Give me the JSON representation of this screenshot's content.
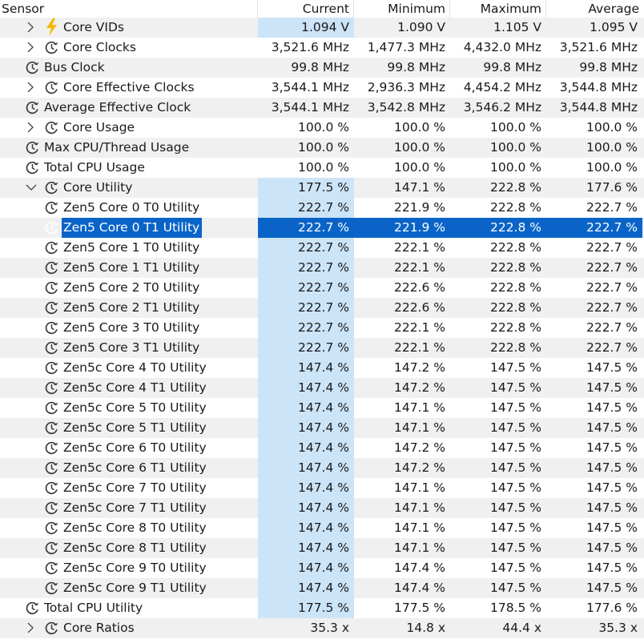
{
  "columns": {
    "sensor": "Sensor",
    "current": "Current",
    "minimum": "Minimum",
    "maximum": "Maximum",
    "average": "Average"
  },
  "rows": [
    {
      "name": "Core VIDs",
      "indent": 1,
      "expander": "collapsed",
      "icon": "lightning-icon",
      "current": "1.094 V",
      "minimum": "1.090 V",
      "maximum": "1.105 V",
      "average": "1.095 V",
      "current_highlight": true
    },
    {
      "name": "Core Clocks",
      "indent": 1,
      "expander": "collapsed",
      "icon": "clock-icon",
      "current": "3,521.6 MHz",
      "minimum": "1,477.3 MHz",
      "maximum": "4,432.0 MHz",
      "average": "3,521.6 MHz"
    },
    {
      "name": "Bus Clock",
      "indent": 0,
      "expander": "none",
      "icon": "clock-icon",
      "current": "99.8 MHz",
      "minimum": "99.8 MHz",
      "maximum": "99.8 MHz",
      "average": "99.8 MHz"
    },
    {
      "name": "Core Effective Clocks",
      "indent": 1,
      "expander": "collapsed",
      "icon": "clock-icon",
      "current": "3,544.1 MHz",
      "minimum": "2,936.3 MHz",
      "maximum": "4,454.2 MHz",
      "average": "3,544.8 MHz"
    },
    {
      "name": "Average Effective Clock",
      "indent": 0,
      "expander": "none",
      "icon": "clock-icon",
      "current": "3,544.1 MHz",
      "minimum": "3,542.8 MHz",
      "maximum": "3,546.2 MHz",
      "average": "3,544.8 MHz"
    },
    {
      "name": "Core Usage",
      "indent": 1,
      "expander": "collapsed",
      "icon": "clock-icon",
      "current": "100.0 %",
      "minimum": "100.0 %",
      "maximum": "100.0 %",
      "average": "100.0 %"
    },
    {
      "name": "Max CPU/Thread Usage",
      "indent": 0,
      "expander": "none",
      "icon": "clock-icon",
      "current": "100.0 %",
      "minimum": "100.0 %",
      "maximum": "100.0 %",
      "average": "100.0 %"
    },
    {
      "name": "Total CPU Usage",
      "indent": 0,
      "expander": "none",
      "icon": "clock-icon",
      "current": "100.0 %",
      "minimum": "100.0 %",
      "maximum": "100.0 %",
      "average": "100.0 %"
    },
    {
      "name": "Core Utility",
      "indent": 1,
      "expander": "expanded",
      "icon": "clock-icon",
      "current": "177.5 %",
      "minimum": "147.1 %",
      "maximum": "222.8 %",
      "average": "177.6 %",
      "current_highlight": true
    },
    {
      "name": "Zen5 Core 0 T0 Utility",
      "indent": 1,
      "expander": "none",
      "icon": "clock-icon",
      "current": "222.7 %",
      "minimum": "221.9 %",
      "maximum": "222.8 %",
      "average": "222.7 %",
      "current_highlight": true
    },
    {
      "name": "Zen5 Core 0 T1 Utility",
      "indent": 1,
      "expander": "none",
      "icon": "clock-icon",
      "current": "222.7 %",
      "minimum": "221.9 %",
      "maximum": "222.8 %",
      "average": "222.7 %",
      "selected": true
    },
    {
      "name": "Zen5 Core 1 T0 Utility",
      "indent": 1,
      "expander": "none",
      "icon": "clock-icon",
      "current": "222.7 %",
      "minimum": "222.1 %",
      "maximum": "222.8 %",
      "average": "222.7 %",
      "current_highlight": true
    },
    {
      "name": "Zen5 Core 1 T1 Utility",
      "indent": 1,
      "expander": "none",
      "icon": "clock-icon",
      "current": "222.7 %",
      "minimum": "222.1 %",
      "maximum": "222.8 %",
      "average": "222.7 %",
      "current_highlight": true
    },
    {
      "name": "Zen5 Core 2 T0 Utility",
      "indent": 1,
      "expander": "none",
      "icon": "clock-icon",
      "current": "222.7 %",
      "minimum": "222.6 %",
      "maximum": "222.8 %",
      "average": "222.7 %",
      "current_highlight": true
    },
    {
      "name": "Zen5 Core 2 T1 Utility",
      "indent": 1,
      "expander": "none",
      "icon": "clock-icon",
      "current": "222.7 %",
      "minimum": "222.6 %",
      "maximum": "222.8 %",
      "average": "222.7 %",
      "current_highlight": true
    },
    {
      "name": "Zen5 Core 3 T0 Utility",
      "indent": 1,
      "expander": "none",
      "icon": "clock-icon",
      "current": "222.7 %",
      "minimum": "222.1 %",
      "maximum": "222.8 %",
      "average": "222.7 %",
      "current_highlight": true
    },
    {
      "name": "Zen5 Core 3 T1 Utility",
      "indent": 1,
      "expander": "none",
      "icon": "clock-icon",
      "current": "222.7 %",
      "minimum": "222.1 %",
      "maximum": "222.8 %",
      "average": "222.7 %",
      "current_highlight": true
    },
    {
      "name": "Zen5c Core 4 T0 Utility",
      "indent": 1,
      "expander": "none",
      "icon": "clock-icon",
      "current": "147.4 %",
      "minimum": "147.2 %",
      "maximum": "147.5 %",
      "average": "147.5 %",
      "current_highlight": true
    },
    {
      "name": "Zen5c Core 4 T1 Utility",
      "indent": 1,
      "expander": "none",
      "icon": "clock-icon",
      "current": "147.4 %",
      "minimum": "147.2 %",
      "maximum": "147.5 %",
      "average": "147.5 %",
      "current_highlight": true
    },
    {
      "name": "Zen5c Core 5 T0 Utility",
      "indent": 1,
      "expander": "none",
      "icon": "clock-icon",
      "current": "147.4 %",
      "minimum": "147.1 %",
      "maximum": "147.5 %",
      "average": "147.5 %",
      "current_highlight": true
    },
    {
      "name": "Zen5c Core 5 T1 Utility",
      "indent": 1,
      "expander": "none",
      "icon": "clock-icon",
      "current": "147.4 %",
      "minimum": "147.1 %",
      "maximum": "147.5 %",
      "average": "147.5 %",
      "current_highlight": true
    },
    {
      "name": "Zen5c Core 6 T0 Utility",
      "indent": 1,
      "expander": "none",
      "icon": "clock-icon",
      "current": "147.4 %",
      "minimum": "147.2 %",
      "maximum": "147.5 %",
      "average": "147.5 %",
      "current_highlight": true
    },
    {
      "name": "Zen5c Core 6 T1 Utility",
      "indent": 1,
      "expander": "none",
      "icon": "clock-icon",
      "current": "147.4 %",
      "minimum": "147.2 %",
      "maximum": "147.5 %",
      "average": "147.5 %",
      "current_highlight": true
    },
    {
      "name": "Zen5c Core 7 T0 Utility",
      "indent": 1,
      "expander": "none",
      "icon": "clock-icon",
      "current": "147.4 %",
      "minimum": "147.1 %",
      "maximum": "147.5 %",
      "average": "147.5 %",
      "current_highlight": true
    },
    {
      "name": "Zen5c Core 7 T1 Utility",
      "indent": 1,
      "expander": "none",
      "icon": "clock-icon",
      "current": "147.4 %",
      "minimum": "147.1 %",
      "maximum": "147.5 %",
      "average": "147.5 %",
      "current_highlight": true
    },
    {
      "name": "Zen5c Core 8 T0 Utility",
      "indent": 1,
      "expander": "none",
      "icon": "clock-icon",
      "current": "147.4 %",
      "minimum": "147.1 %",
      "maximum": "147.5 %",
      "average": "147.5 %",
      "current_highlight": true
    },
    {
      "name": "Zen5c Core 8 T1 Utility",
      "indent": 1,
      "expander": "none",
      "icon": "clock-icon",
      "current": "147.4 %",
      "minimum": "147.1 %",
      "maximum": "147.5 %",
      "average": "147.5 %",
      "current_highlight": true
    },
    {
      "name": "Zen5c Core 9 T0 Utility",
      "indent": 1,
      "expander": "none",
      "icon": "clock-icon",
      "current": "147.4 %",
      "minimum": "147.4 %",
      "maximum": "147.5 %",
      "average": "147.5 %",
      "current_highlight": true
    },
    {
      "name": "Zen5c Core 9 T1 Utility",
      "indent": 1,
      "expander": "none",
      "icon": "clock-icon",
      "current": "147.4 %",
      "minimum": "147.4 %",
      "maximum": "147.5 %",
      "average": "147.5 %",
      "current_highlight": true
    },
    {
      "name": "Total CPU Utility",
      "indent": 0,
      "expander": "none",
      "icon": "clock-icon",
      "current": "177.5 %",
      "minimum": "177.5 %",
      "maximum": "178.5 %",
      "average": "177.6 %",
      "current_highlight": true
    },
    {
      "name": "Core Ratios",
      "indent": 1,
      "expander": "collapsed",
      "icon": "clock-icon",
      "current": "35.3 x",
      "minimum": "14.8 x",
      "maximum": "44.4 x",
      "average": "35.3 x"
    }
  ],
  "colors": {
    "selection": "#0a64c8",
    "current_highlight": "#cce4f7",
    "alt_row": "#f0f0f0",
    "lightning": "#f5b800",
    "icon_gray": "#3a3a3a"
  }
}
